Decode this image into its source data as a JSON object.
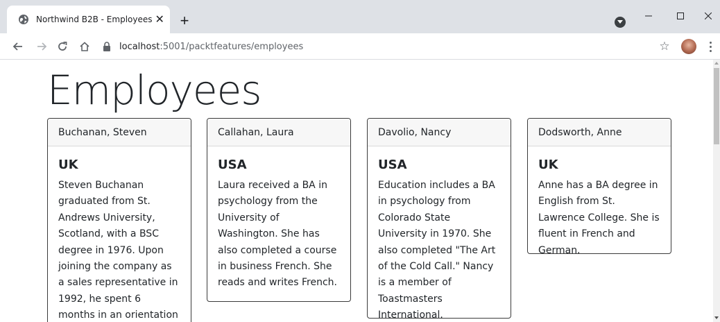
{
  "browser": {
    "tab_title": "Northwind B2B - Employees",
    "tab_close": "✕",
    "new_tab": "+",
    "url_host": "localhost",
    "url_path": ":5001/packtfeatures/employees",
    "icons": {
      "favicon": "globe-icon",
      "back": "back-arrow-icon",
      "forward": "forward-arrow-icon",
      "reload": "reload-icon",
      "home": "home-icon",
      "lock": "lock-icon",
      "star": "star-icon",
      "profile": "avatar",
      "menu": "kebab-menu-icon"
    }
  },
  "page": {
    "title": "Employees"
  },
  "employees": [
    {
      "name": "Buchanan, Steven",
      "country": "UK",
      "notes": "Steven Buchanan graduated from St. Andrews University, Scotland, with a BSC degree in 1976. Upon joining the company as a sales representative in 1992, he spent 6 months in an orientation"
    },
    {
      "name": "Callahan, Laura",
      "country": "USA",
      "notes": "Laura received a BA in psychology from the University of Washington. She has also completed a course in business French. She reads and writes French."
    },
    {
      "name": "Davolio, Nancy",
      "country": "USA",
      "notes": "Education includes a BA in psychology from Colorado State University in 1970. She also completed \"The Art of the Cold Call.\" Nancy is a member of Toastmasters International."
    },
    {
      "name": "Dodsworth, Anne",
      "country": "UK",
      "notes": "Anne has a BA degree in English from St. Lawrence College. She is fluent in French and German."
    }
  ]
}
